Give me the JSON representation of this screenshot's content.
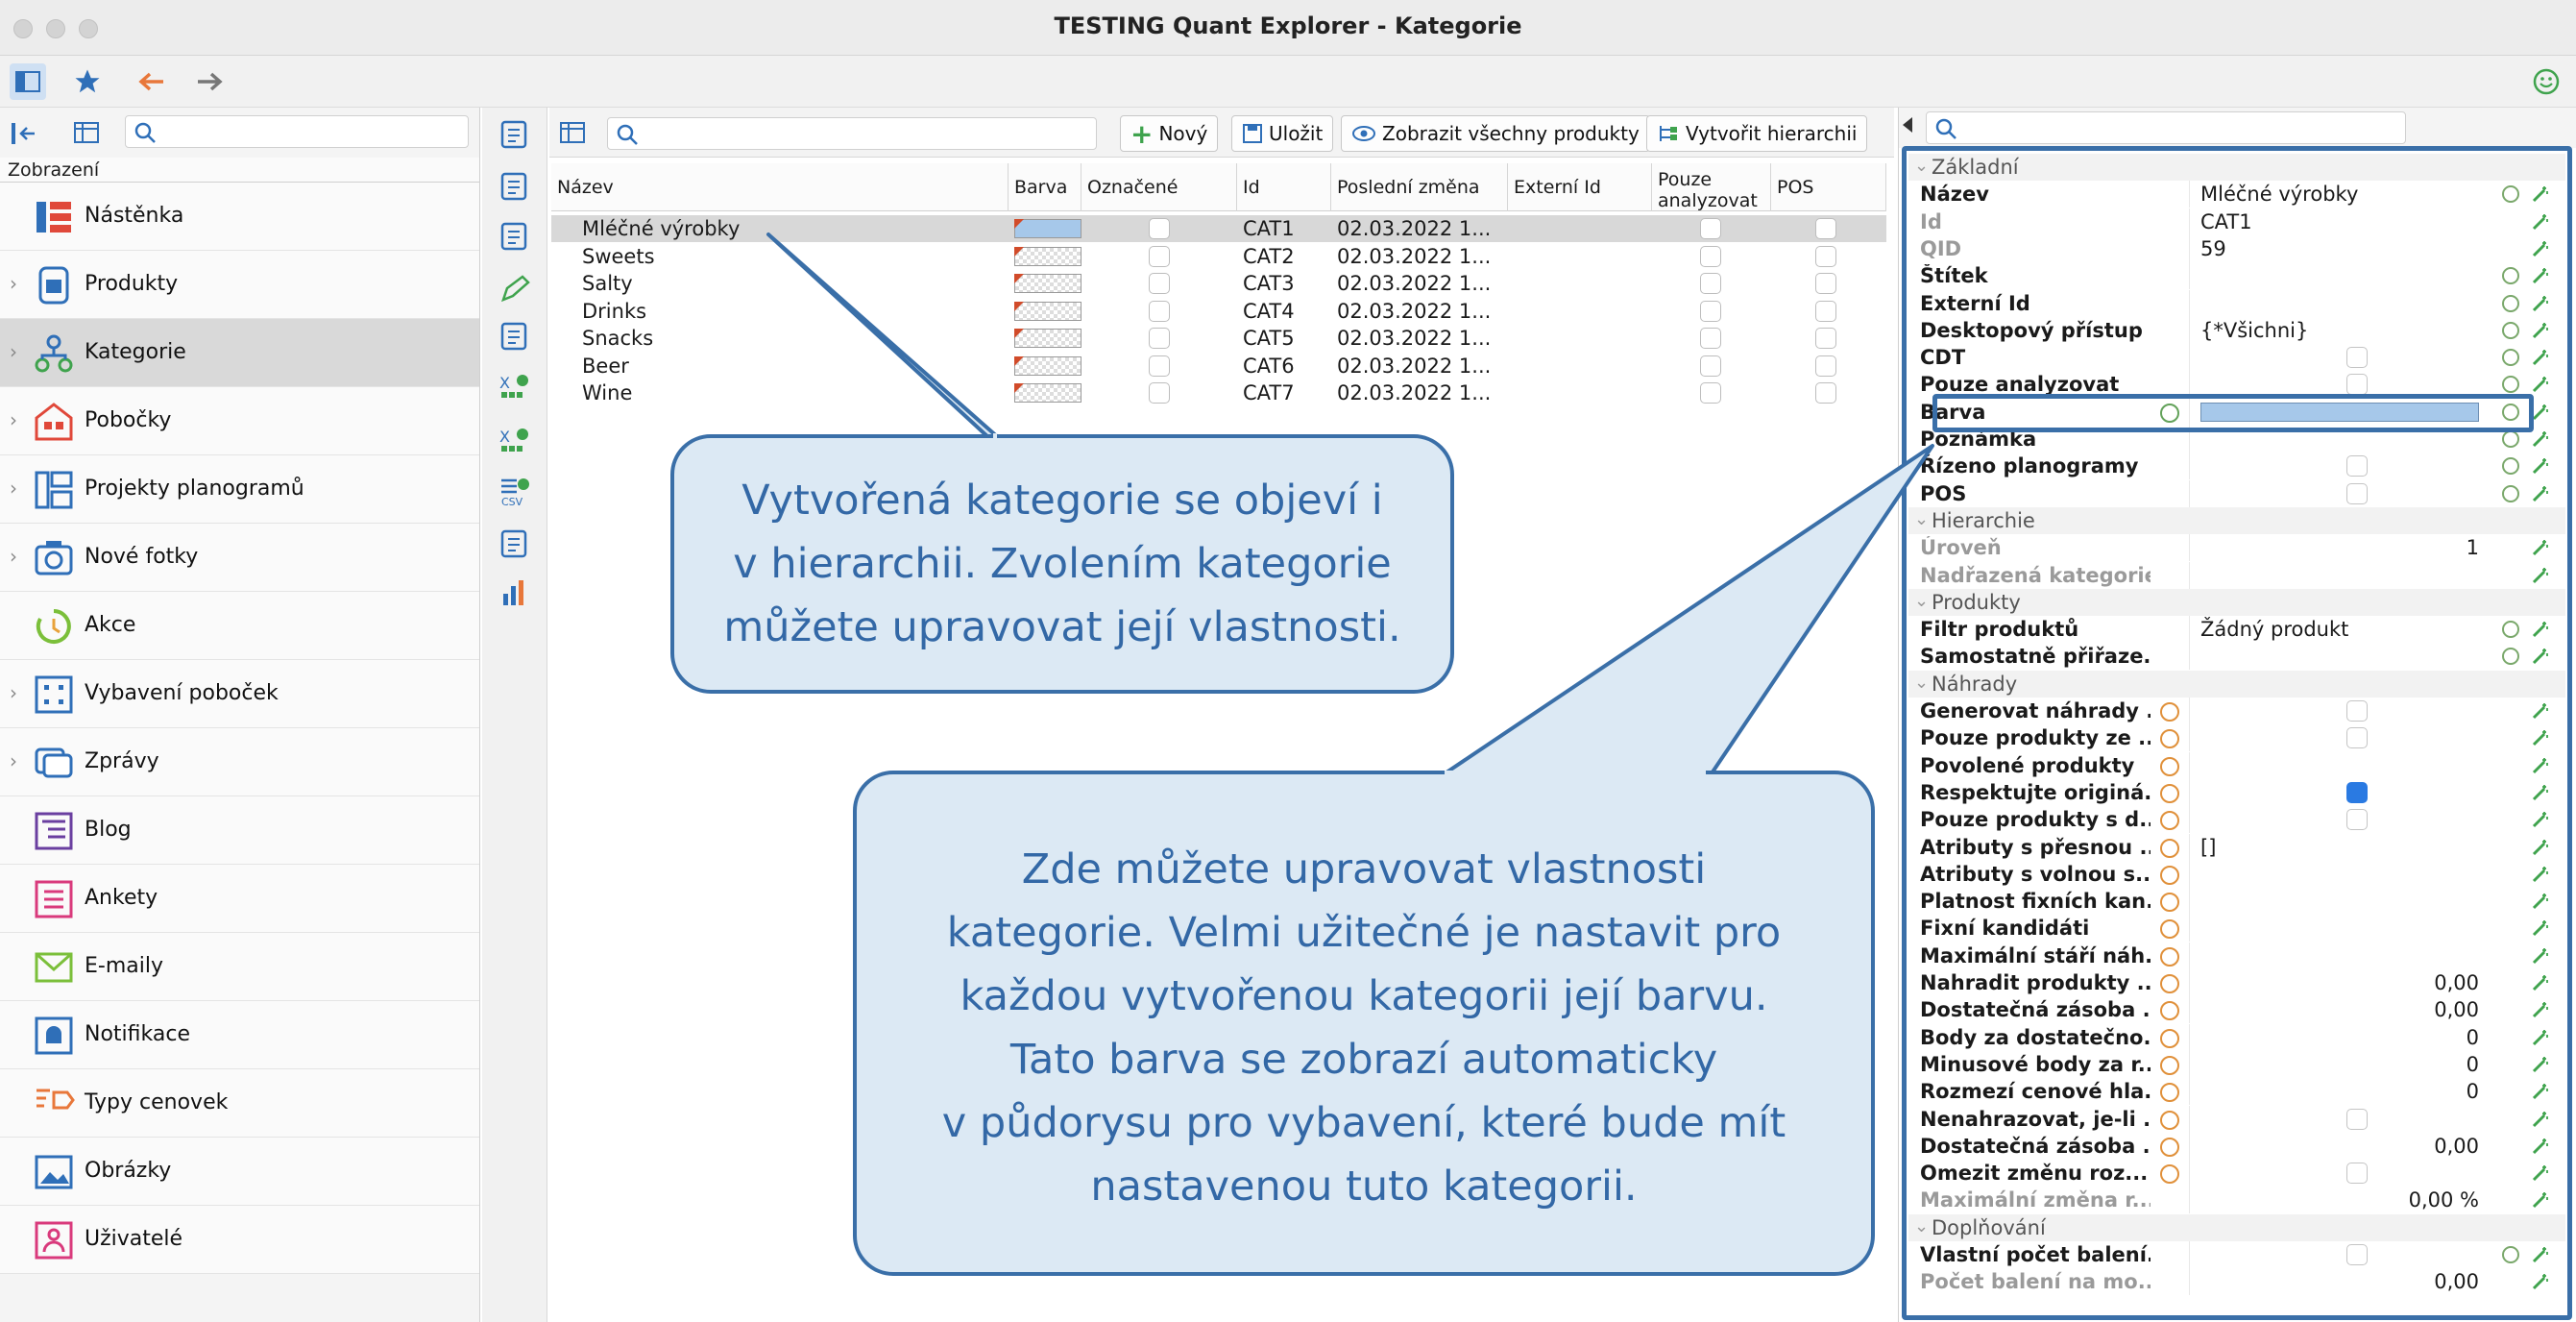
{
  "window": {
    "title": "TESTING Quant Explorer - Kategorie"
  },
  "sidebar": {
    "header": "Zobrazení",
    "items": [
      {
        "label": "Nástěnka",
        "icon": "dashboard-icon",
        "chevron": false
      },
      {
        "label": "Produkty",
        "icon": "products-icon",
        "chevron": true
      },
      {
        "label": "Kategorie",
        "icon": "hierarchy-icon",
        "chevron": true,
        "selected": true
      },
      {
        "label": "Pobočky",
        "icon": "store-icon",
        "chevron": true
      },
      {
        "label": "Projekty planogramů",
        "icon": "planogram-icon",
        "chevron": true
      },
      {
        "label": "Nové fotky",
        "icon": "camera-icon",
        "chevron": true
      },
      {
        "label": "Akce",
        "icon": "cycle-icon",
        "chevron": false
      },
      {
        "label": "Vybavení poboček",
        "icon": "grid-icon",
        "chevron": true
      },
      {
        "label": "Zprávy",
        "icon": "message-icon",
        "chevron": true
      },
      {
        "label": "Blog",
        "icon": "blog-icon",
        "chevron": false
      },
      {
        "label": "Ankety",
        "icon": "survey-icon",
        "chevron": false
      },
      {
        "label": "E-maily",
        "icon": "mail-icon",
        "chevron": false
      },
      {
        "label": "Notifikace",
        "icon": "bell-icon",
        "chevron": false
      },
      {
        "label": "Typy cenovek",
        "icon": "price-tag-icon",
        "chevron": false
      },
      {
        "label": "Obrázky",
        "icon": "image-icon",
        "chevron": false
      },
      {
        "label": "Uživatelé",
        "icon": "user-icon",
        "chevron": false
      }
    ]
  },
  "center": {
    "buttons": {
      "new": "Nový",
      "save": "Uložit",
      "show_all": "Zobrazit všechny produkty",
      "create_hierarchy": "Vytvořit hierarchii"
    },
    "columns": {
      "name": "Název",
      "color": "Barva",
      "marked": "Označené",
      "id": "Id",
      "last_change": "Poslední změna",
      "external_id": "Externí Id",
      "analyzed_l1": "Pouze",
      "analyzed_l2": "analyzovat",
      "pos": "POS"
    },
    "rows": [
      {
        "name": "Mléčné výrobky",
        "id": "CAT1",
        "date": "02.03.2022 1...",
        "color": "blue",
        "selected": true
      },
      {
        "name": "Sweets",
        "id": "CAT2",
        "date": "02.03.2022 1...",
        "color": "empty"
      },
      {
        "name": "Salty",
        "id": "CAT3",
        "date": "02.03.2022 1...",
        "color": "empty"
      },
      {
        "name": "Drinks",
        "id": "CAT4",
        "date": "02.03.2022 1...",
        "color": "empty"
      },
      {
        "name": "Snacks",
        "id": "CAT5",
        "date": "02.03.2022 1...",
        "color": "empty"
      },
      {
        "name": "Beer",
        "id": "CAT6",
        "date": "02.03.2022 1...",
        "color": "empty"
      },
      {
        "name": "Wine",
        "id": "CAT7",
        "date": "02.03.2022 1...",
        "color": "empty"
      }
    ]
  },
  "properties": [
    {
      "type": "section",
      "label": "Základní"
    },
    {
      "label": "Název",
      "value": "Mléčné výrobky",
      "reset": true
    },
    {
      "label": "Id",
      "value": "CAT1",
      "disabled": true
    },
    {
      "label": "QID",
      "value": "59",
      "disabled": true
    },
    {
      "label": "Štítek",
      "value": "",
      "reset": true
    },
    {
      "label": "Externí Id",
      "value": "",
      "reset": true
    },
    {
      "label": "Desktopový přístup",
      "value": "{*Všichni}",
      "reset": true
    },
    {
      "label": "CDT",
      "checkbox": false,
      "reset": true
    },
    {
      "label": "Pouze analyzovat",
      "checkbox": false,
      "reset": true
    },
    {
      "label": "Barva",
      "color_bar": true,
      "reset": true,
      "highlight": true
    },
    {
      "label": "Poznámka",
      "value": "",
      "reset": true
    },
    {
      "label": "Řízeno planogramy",
      "checkbox": false,
      "reset": true
    },
    {
      "label": "POS",
      "checkbox": false,
      "reset": true
    },
    {
      "type": "section",
      "label": "Hierarchie"
    },
    {
      "label": "Úroveň",
      "value_right": "1",
      "disabled": true
    },
    {
      "label": "Nadřazená kategorie",
      "value": "",
      "disabled": true
    },
    {
      "type": "section",
      "label": "Produkty"
    },
    {
      "label": "Filtr produktů",
      "value": "Žádný produkt",
      "reset": true
    },
    {
      "label": "Samostatně přiřaze...",
      "value": "",
      "reset": true
    },
    {
      "type": "section",
      "label": "Náhrady"
    },
    {
      "label": "Generovat náhrady ...",
      "checkbox": false,
      "orange": true
    },
    {
      "label": "Pouze produkty ze ...",
      "checkbox": false,
      "orange": true
    },
    {
      "label": "Povolené produkty",
      "value": "",
      "orange": true
    },
    {
      "label": "Respektujte originá...",
      "checkbox": true,
      "orange": true
    },
    {
      "label": "Pouze produkty s d...",
      "checkbox": false,
      "orange": true
    },
    {
      "label": "Atributy s přesnou ...",
      "value": "[]",
      "orange": true
    },
    {
      "label": "Atributy s volnou s...",
      "value": "",
      "orange": true
    },
    {
      "label": "Platnost fixních kan...",
      "value": "",
      "orange": true
    },
    {
      "label": "Fixní kandidáti",
      "value": "",
      "orange": true
    },
    {
      "label": "Maximální stáří náh...",
      "value": "",
      "orange": true
    },
    {
      "label": "Nahradit produkty ...",
      "value_right": "0,00",
      "orange": true
    },
    {
      "label": "Dostatečná zásoba ...",
      "value_right": "0,00",
      "orange": true
    },
    {
      "label": "Body za dostatečno...",
      "value_right": "0",
      "orange": true
    },
    {
      "label": "Minusové body za r...",
      "value_right": "0",
      "orange": true
    },
    {
      "label": "Rozmezí cenové hla...",
      "value_right": "0",
      "orange": true
    },
    {
      "label": "Nenahrazovat, je-li ...",
      "checkbox": false,
      "orange": true
    },
    {
      "label": "Dostatečná zásoba ...",
      "value_right": "0,00",
      "orange": true
    },
    {
      "label": "Omezit změnu roz...",
      "checkbox": false,
      "orange": true
    },
    {
      "label": "Maximální změna r...",
      "value_right": "0,00 %",
      "disabled": true
    },
    {
      "type": "section",
      "label": "Doplňování"
    },
    {
      "label": "Vlastní počet balení...",
      "checkbox": false,
      "reset": true
    },
    {
      "label": "Počet balení na mo...",
      "value_right": "0,00",
      "disabled": true
    }
  ],
  "callouts": {
    "first": [
      "Vytvořená kategorie se objeví i",
      "v hierarchii. Zvolením kategorie",
      "můžete upravovat její vlastnosti."
    ],
    "second": [
      "Zde můžete upravovat vlastnosti",
      "kategorie. Velmi užitečné je nastavit pro",
      "každou vytvořenou kategorii její barvu.",
      "Tato barva se zobrazí automaticky",
      "v půdorysu pro vybavení, které bude mít",
      "nastavenou tuto kategorii."
    ]
  },
  "colors": {
    "accent": "#3a6fa8",
    "bubble_bg": "#dce9f4",
    "bubble_text": "#3368a6",
    "category_color": "#a6c8ea"
  }
}
